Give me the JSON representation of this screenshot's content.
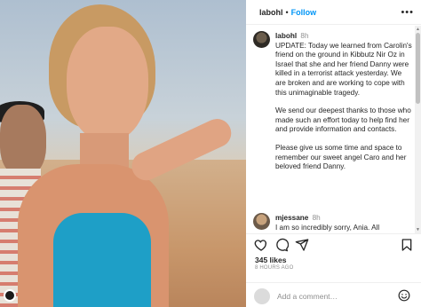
{
  "post": {
    "username": "labohl",
    "separator": "•",
    "follow_label": "Follow",
    "more_label": "•••"
  },
  "caption": {
    "username": "labohl",
    "time": "8h",
    "paragraphs": [
      "UPDATE: Today we learned from Carolin's friend on the ground in Kibbutz Nir Oz in Israel that she and her friend Danny were killed in a terrorist attack yesterday. We are broken and are working to cope with this unimaginable tragedy.",
      "We send our deepest thanks to those who made such an effort today to help find her and provide information and contacts.",
      "Please give us some time and space to remember our sweet angel Caro and her beloved friend Danny."
    ]
  },
  "comments": [
    {
      "username": "mjessane",
      "time": "8h",
      "text": "I am so incredibly sorry, Ania. All"
    }
  ],
  "actions": {
    "like_icon": "heart-icon",
    "comment_icon": "comment-icon",
    "share_icon": "share-icon",
    "save_icon": "bookmark-icon"
  },
  "stats": {
    "likes": "345 likes",
    "posted": "8 HOURS AGO"
  },
  "add_comment": {
    "placeholder": "Add a comment…",
    "emoji_icon": "emoji-icon"
  },
  "colors": {
    "accent": "#0095f6",
    "swimsuit": "#1e9fc7"
  }
}
